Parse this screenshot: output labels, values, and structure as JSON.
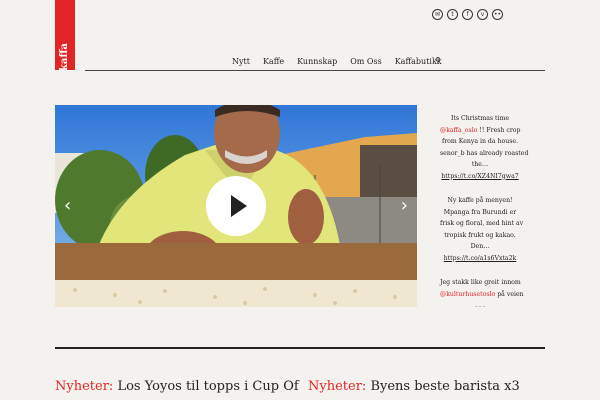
{
  "logo": {
    "text": "kaffa"
  },
  "social": [
    {
      "name": "mail",
      "glyph": "✉"
    },
    {
      "name": "twitter",
      "glyph": "t"
    },
    {
      "name": "facebook",
      "glyph": "f"
    },
    {
      "name": "vimeo",
      "glyph": "v"
    },
    {
      "name": "flickr",
      "glyph": "••"
    }
  ],
  "nav": {
    "items": [
      "Nytt",
      "Kaffe",
      "Kunnskap",
      "Om Oss",
      "Kaffabutikk"
    ],
    "search_glyph": "⚲"
  },
  "slider": {
    "prev_glyph": "‹",
    "next_glyph": "›"
  },
  "tweets": [
    {
      "lines": [
        "Its Christmas time",
        "@kaffa_oslo !! Fresh crop",
        "from Kenya in da house.",
        "senor_b has already roasted",
        "the…",
        "https://t.co/XZ4NI7gwa7"
      ]
    },
    {
      "lines": [
        "Ny kaffe på menyen!",
        "Mpanga fra Burundi er",
        "frisk og floral, med hint av",
        "tropisk frukt og kakao.",
        "Den…",
        "https://t.co/a1s6Vxta2k"
      ]
    },
    {
      "lines": [
        "Jeg stakk like greit innom",
        "@kulturhusetoslo på veien",
        ". . ."
      ]
    }
  ],
  "posts": [
    {
      "category": "Nyheter:",
      "title": "Los Yoyos til topps i Cup Of"
    },
    {
      "category": "Nyheter:",
      "title": "Byens beste barista x3"
    }
  ],
  "colors": {
    "accent": "#e22424",
    "background": "#f4f2ee"
  }
}
